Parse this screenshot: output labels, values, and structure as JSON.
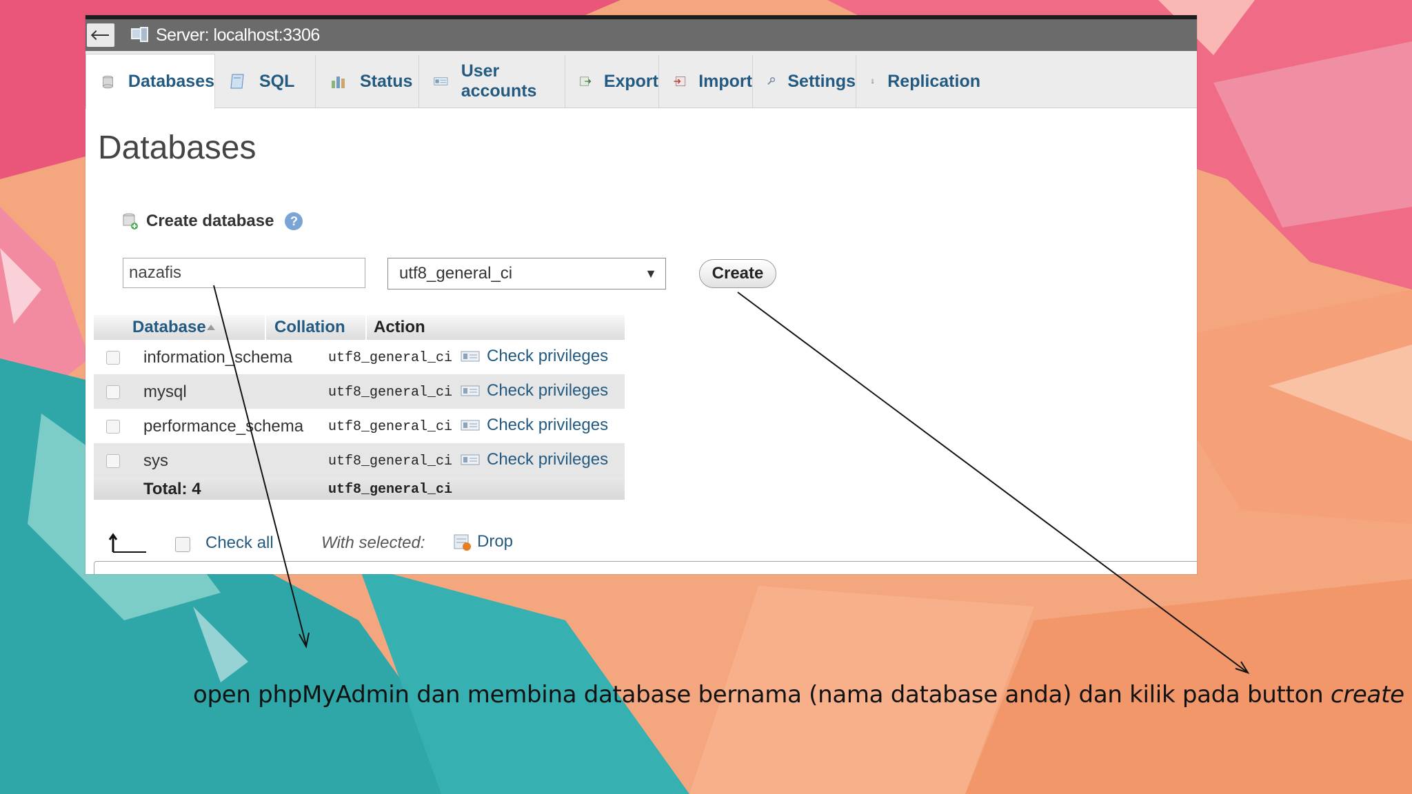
{
  "window": {
    "server_label": "Server: localhost:3306"
  },
  "tabs": [
    {
      "label": "Databases",
      "icon": "database-icon",
      "active": true
    },
    {
      "label": "SQL",
      "icon": "sql-icon",
      "active": false
    },
    {
      "label": "Status",
      "icon": "status-icon",
      "active": false
    },
    {
      "label": "User accounts",
      "icon": "user-accounts-icon",
      "active": false
    },
    {
      "label": "Export",
      "icon": "export-icon",
      "active": false
    },
    {
      "label": "Import",
      "icon": "import-icon",
      "active": false
    },
    {
      "label": "Settings",
      "icon": "wrench-icon",
      "active": false
    },
    {
      "label": "Replication",
      "icon": "replication-icon",
      "active": false
    }
  ],
  "page": {
    "title": "Databases"
  },
  "create_database": {
    "heading": "Create database",
    "name_value": "nazafis",
    "collation_value": "utf8_general_ci",
    "button_label": "Create"
  },
  "table": {
    "headers": {
      "database": "Database",
      "collation": "Collation",
      "action": "Action"
    },
    "rows": [
      {
        "name": "information_schema",
        "collation": "utf8_general_ci",
        "action": "Check privileges"
      },
      {
        "name": "mysql",
        "collation": "utf8_general_ci",
        "action": "Check privileges"
      },
      {
        "name": "performance_schema",
        "collation": "utf8_general_ci",
        "action": "Check privileges"
      },
      {
        "name": "sys",
        "collation": "utf8_general_ci",
        "action": "Check privileges"
      }
    ],
    "total_label": "Total: 4",
    "total_collation": "utf8_general_ci"
  },
  "footer": {
    "check_all_label": "Check all",
    "with_selected_label": "With selected:",
    "drop_label": "Drop"
  },
  "caption": {
    "text": "open phpMyAdmin dan membina database bernama (nama database anda) dan kilik pada button",
    "emphasis": "create"
  },
  "colors": {
    "link_blue": "#235a81",
    "titlebar_gray": "#6b6b6b",
    "background_coral": "#f3a77c",
    "background_teal": "#2aa7a8",
    "background_pink": "#e8506a"
  }
}
